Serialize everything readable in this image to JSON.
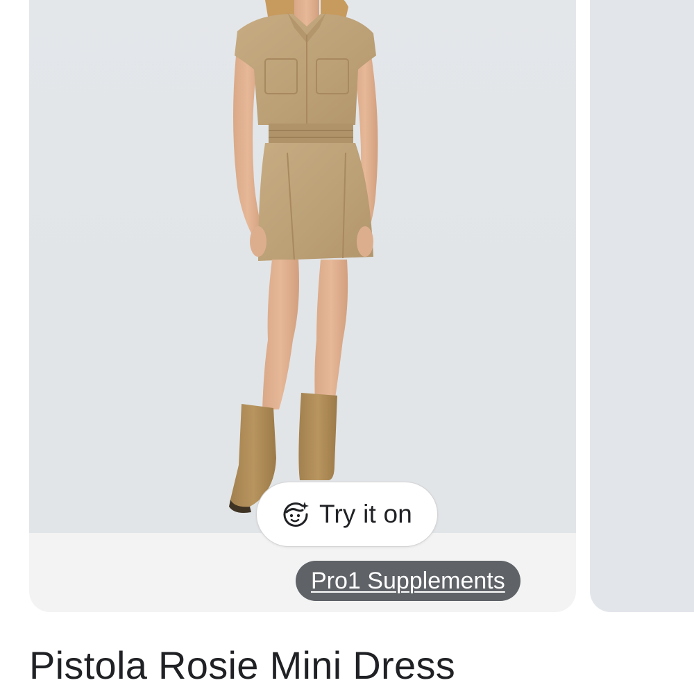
{
  "product": {
    "title": "Pistola Rosie Mini Dress",
    "image_subject": "model-wearing-khaki-mini-dress-and-tan-boots"
  },
  "try_on": {
    "label": "Try it on",
    "icon": "face-sparkle-icon"
  },
  "merchant": {
    "name": "Pro1 Supplements"
  },
  "colors": {
    "card_background": "#f3f3f3",
    "image_background": "#e3e6e9",
    "dress": "#bfa37a",
    "boots": "#b08d5a",
    "merchant_badge": "#5f6368",
    "text": "#202124"
  }
}
